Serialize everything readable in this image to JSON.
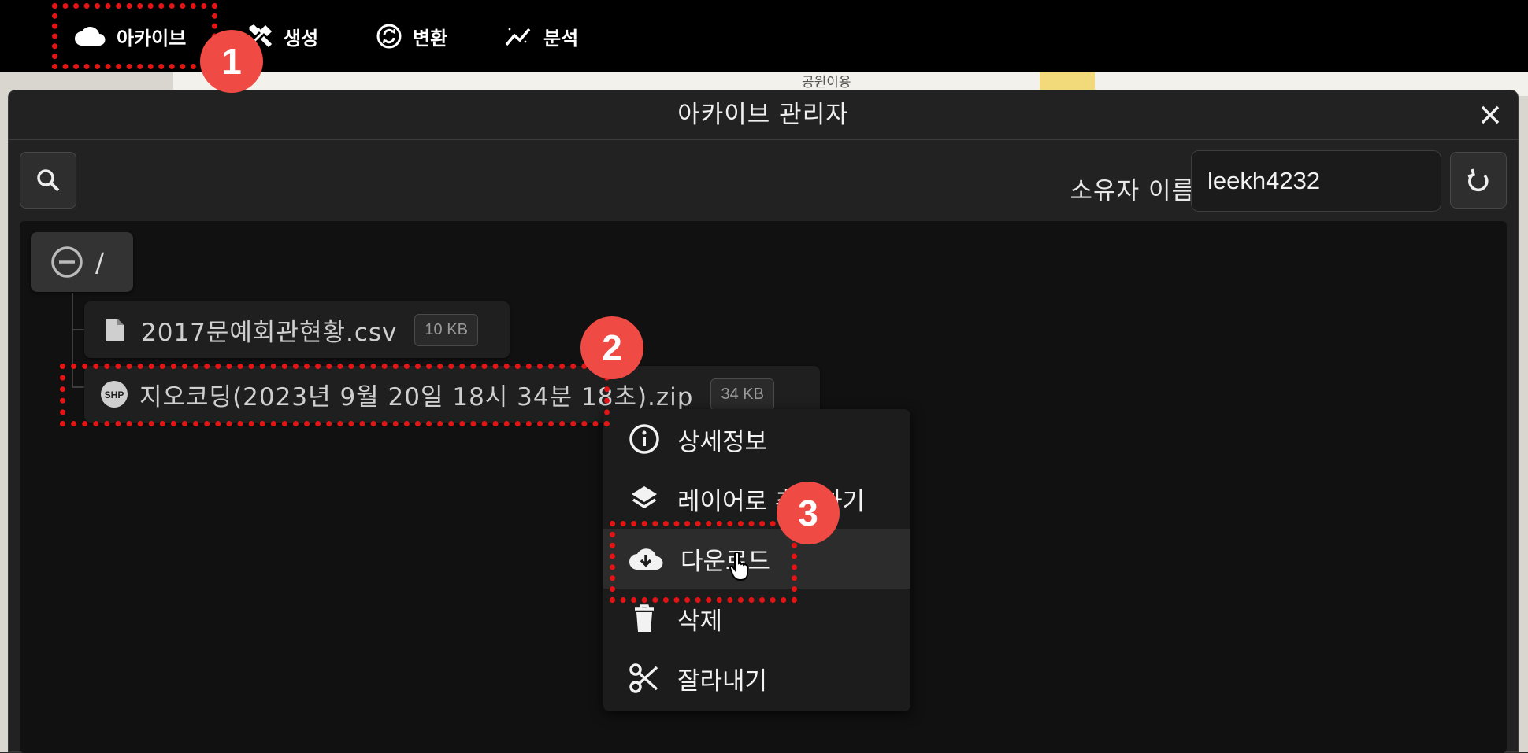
{
  "nav": {
    "items": [
      {
        "label": "아카이브",
        "icon": "cloud-icon"
      },
      {
        "label": "생성",
        "icon": "tools-icon"
      },
      {
        "label": "변환",
        "icon": "convert-icon"
      },
      {
        "label": "분석",
        "icon": "analysis-icon"
      }
    ]
  },
  "map": {
    "labels": [
      "공원이용"
    ]
  },
  "dialog": {
    "title": "아카이브 관리자",
    "owner_label": "소유자 이름",
    "owner_value": "leekh4232"
  },
  "tree": {
    "root_label": "/",
    "files": [
      {
        "name": "2017문예회관현황.csv",
        "size": "10 KB",
        "icon": "file-icon"
      },
      {
        "name": "지오코딩(2023년 9월 20일 18시 34분 18초).zip",
        "size": "34 KB",
        "icon": "shp-icon"
      }
    ]
  },
  "context_menu": {
    "items": [
      {
        "label": "상세정보",
        "icon": "info-icon"
      },
      {
        "label": "레이어로 추가하기",
        "icon": "layers-icon"
      },
      {
        "label": "다운로드",
        "icon": "cloud-download-icon"
      },
      {
        "label": "삭제",
        "icon": "trash-icon"
      },
      {
        "label": "잘라내기",
        "icon": "scissors-icon"
      }
    ]
  },
  "annotations": {
    "steps": [
      "1",
      "2",
      "3"
    ],
    "color": "#e41414"
  }
}
